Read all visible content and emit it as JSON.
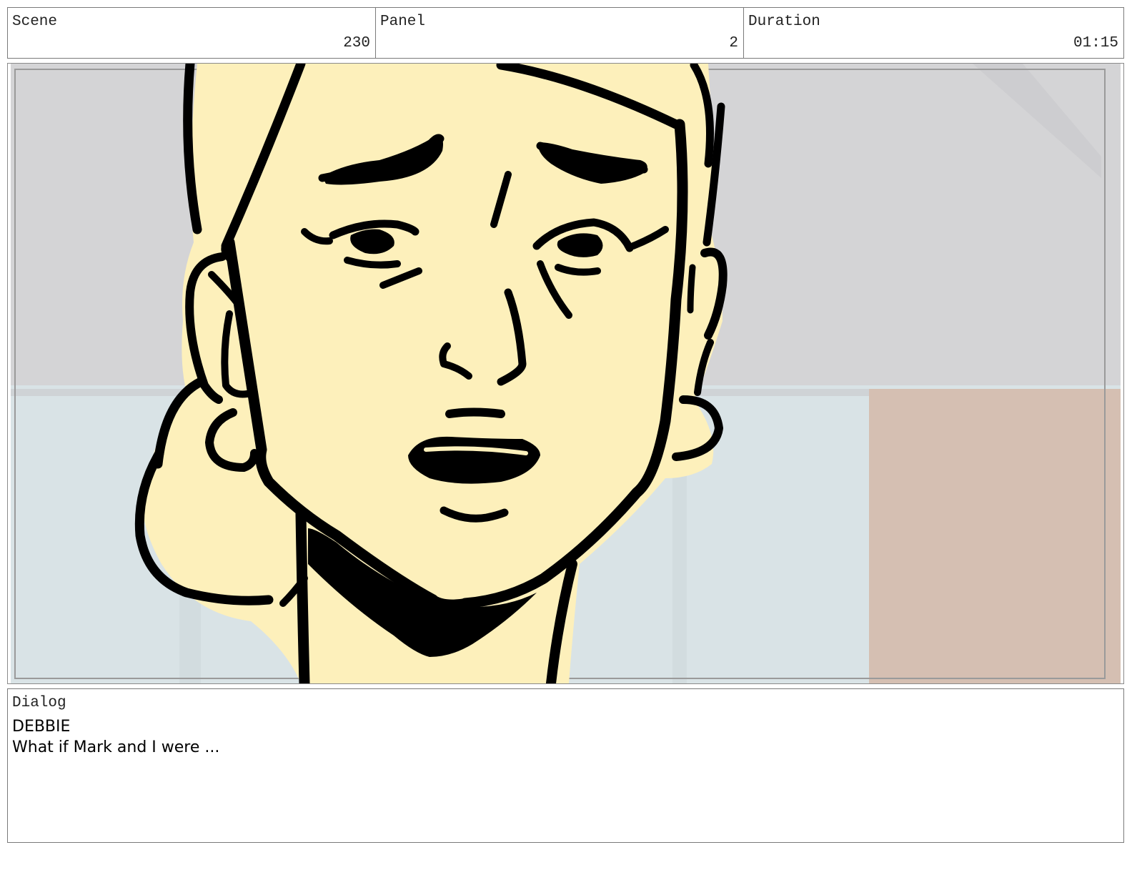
{
  "header": {
    "scene": {
      "label": "Scene",
      "value": "230"
    },
    "panel": {
      "label": "Panel",
      "value": "2"
    },
    "duration": {
      "label": "Duration",
      "value": "01:15"
    }
  },
  "frame": {
    "subject_icon": "cartoon-face-drawing",
    "colors": {
      "skin": "#fdf0bb",
      "ink": "#000000",
      "ceiling": "#d4d4d6",
      "wall_blue": "#d9e3e6",
      "wall_pink": "#d5bfb2",
      "border": "#8a8a8a"
    }
  },
  "dialog": {
    "label": "Dialog",
    "speaker": "DEBBIE",
    "line": "What if Mark and I were ..."
  }
}
